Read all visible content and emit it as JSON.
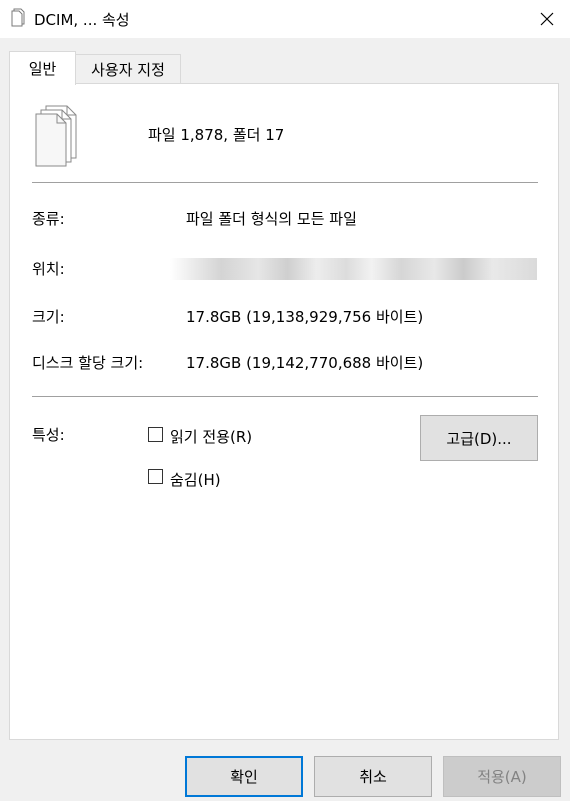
{
  "window": {
    "title": "DCIM, ... 속성"
  },
  "tabs": [
    {
      "label": "일반",
      "active": true
    },
    {
      "label": "사용자 지정",
      "active": false
    }
  ],
  "general": {
    "summary": "파일 1,878, 폴더 17",
    "type_label": "종류:",
    "type_value": "파일 폴더 형식의 모든 파일",
    "location_label": "위치:",
    "size_label": "크기:",
    "size_value": "17.8GB (19,138,929,756 바이트)",
    "disk_size_label": "디스크 할당 크기:",
    "disk_size_value": "17.8GB (19,142,770,688 바이트)",
    "attributes_label": "특성:",
    "readonly_label": "읽기 전용(R)",
    "readonly_checked": false,
    "hidden_label": "숨김(H)",
    "hidden_checked": false,
    "advanced_button": "고급(D)..."
  },
  "buttons": {
    "ok": "확인",
    "cancel": "취소",
    "apply": "적용(A)"
  },
  "icons": {
    "title": "files-icon",
    "close": "close-icon",
    "summary": "multiple-files-icon"
  }
}
